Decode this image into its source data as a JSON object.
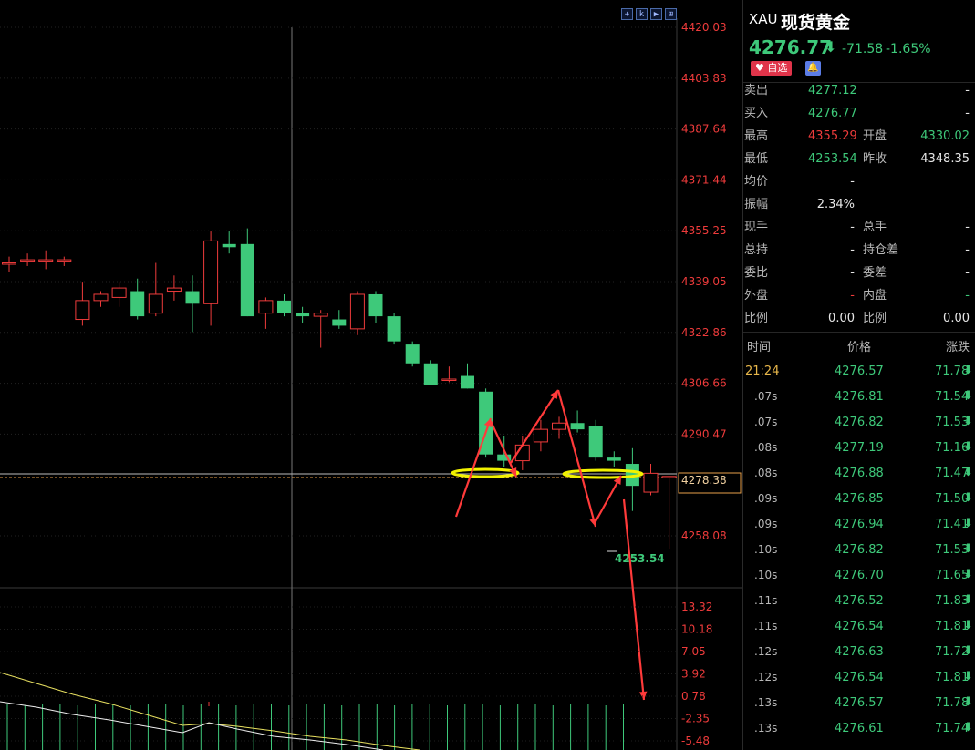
{
  "toolbar": {
    "buttons": [
      {
        "name": "crosshair-icon",
        "glyph": "+"
      },
      {
        "name": "indicator-icon",
        "glyph": "k"
      },
      {
        "name": "play-icon",
        "glyph": "▶"
      },
      {
        "name": "fullscreen-icon",
        "glyph": "⊞"
      }
    ]
  },
  "chart_data": {
    "type": "candlestick",
    "title": "",
    "ylim": [
      4245,
      4425
    ],
    "price_ticks": [
      "4420.03",
      "4403.83",
      "4387.64",
      "4371.44",
      "4355.25",
      "4339.05",
      "4322.86",
      "4306.66",
      "4290.47",
      "4278.38",
      "4258.08"
    ],
    "current_price_label": "4278.38",
    "low_marker_label": "4253.54",
    "candles": [
      {
        "o": 4345,
        "h": 4347,
        "l": 4342,
        "c": 4345
      },
      {
        "o": 4346,
        "h": 4348,
        "l": 4344,
        "c": 4346
      },
      {
        "o": 4346,
        "h": 4349,
        "l": 4343,
        "c": 4346
      },
      {
        "o": 4346,
        "h": 4347,
        "l": 4344,
        "c": 4346
      },
      {
        "o": 4327,
        "h": 4339,
        "l": 4325,
        "c": 4333
      },
      {
        "o": 4333,
        "h": 4336,
        "l": 4331,
        "c": 4335
      },
      {
        "o": 4334,
        "h": 4339,
        "l": 4331,
        "c": 4337
      },
      {
        "o": 4336,
        "h": 4340,
        "l": 4327,
        "c": 4328
      },
      {
        "o": 4329,
        "h": 4345,
        "l": 4328,
        "c": 4335
      },
      {
        "o": 4336,
        "h": 4341,
        "l": 4333,
        "c": 4337
      },
      {
        "o": 4336,
        "h": 4341,
        "l": 4323,
        "c": 4332
      },
      {
        "o": 4332,
        "h": 4355,
        "l": 4325,
        "c": 4352
      },
      {
        "o": 4351,
        "h": 4355,
        "l": 4348,
        "c": 4350
      },
      {
        "o": 4351,
        "h": 4356,
        "l": 4328,
        "c": 4328
      },
      {
        "o": 4329,
        "h": 4334,
        "l": 4324,
        "c": 4333
      },
      {
        "o": 4333,
        "h": 4335,
        "l": 4328,
        "c": 4329
      },
      {
        "o": 4329,
        "h": 4331,
        "l": 4326,
        "c": 4328
      },
      {
        "o": 4328,
        "h": 4330,
        "l": 4318,
        "c": 4329
      },
      {
        "o": 4327,
        "h": 4330,
        "l": 4324,
        "c": 4325
      },
      {
        "o": 4324,
        "h": 4336,
        "l": 4322,
        "c": 4335
      },
      {
        "o": 4335,
        "h": 4336,
        "l": 4326,
        "c": 4328
      },
      {
        "o": 4328,
        "h": 4329,
        "l": 4319,
        "c": 4320
      },
      {
        "o": 4319,
        "h": 4320,
        "l": 4312,
        "c": 4313
      },
      {
        "o": 4313,
        "h": 4314,
        "l": 4306,
        "c": 4306
      },
      {
        "o": 4308,
        "h": 4312,
        "l": 4307,
        "c": 4308
      },
      {
        "o": 4309,
        "h": 4313,
        "l": 4305,
        "c": 4305
      },
      {
        "o": 4304,
        "h": 4305,
        "l": 4283,
        "c": 4284
      },
      {
        "o": 4284,
        "h": 4290,
        "l": 4280,
        "c": 4282
      },
      {
        "o": 4282,
        "h": 4290,
        "l": 4279,
        "c": 4287
      },
      {
        "o": 4288,
        "h": 4295,
        "l": 4285,
        "c": 4292
      },
      {
        "o": 4292,
        "h": 4296,
        "l": 4289,
        "c": 4294
      },
      {
        "o": 4294,
        "h": 4298,
        "l": 4291,
        "c": 4292
      },
      {
        "o": 4293,
        "h": 4295,
        "l": 4282,
        "c": 4283
      },
      {
        "o": 4283,
        "h": 4285,
        "l": 4280,
        "c": 4282
      },
      {
        "o": 4281,
        "h": 4286,
        "l": 4266,
        "c": 4274
      },
      {
        "o": 4272,
        "h": 4281,
        "l": 4271,
        "c": 4278
      },
      {
        "o": 4277,
        "h": 4277,
        "l": 4254,
        "c": 4277
      }
    ],
    "macd_ticks": [
      "13.32",
      "10.18",
      "7.05",
      "3.92",
      "0.78",
      "-2.35",
      "-5.48"
    ],
    "macd_ylim": [
      -5.8,
      14.5
    ]
  },
  "quote": {
    "symbol": "XAU",
    "name": "现货黄金",
    "price": "4276.77",
    "arrow": "⬇",
    "change": "-71.58",
    "change_pct": "-1.65%",
    "fav_label": "自选",
    "rows": [
      {
        "l1": "卖出",
        "v1": "4277.12",
        "c1": "green",
        "l2": "",
        "v2": "-",
        "c2": "white"
      },
      {
        "l1": "买入",
        "v1": "4276.77",
        "c1": "green",
        "l2": "",
        "v2": "-",
        "c2": "white"
      },
      {
        "l1": "最高",
        "v1": "4355.29",
        "c1": "red",
        "l2": "开盘",
        "v2": "4330.02",
        "c2": "green"
      },
      {
        "l1": "最低",
        "v1": "4253.54",
        "c1": "green",
        "l2": "昨收",
        "v2": "4348.35",
        "c2": "white"
      },
      {
        "l1": "均价",
        "v1": "-",
        "c1": "white",
        "l2": "",
        "v2": "",
        "c2": "white"
      },
      {
        "l1": "振幅",
        "v1": "2.34%",
        "c1": "white",
        "l2": "",
        "v2": "",
        "c2": "white"
      },
      {
        "l1": "现手",
        "v1": "-",
        "c1": "white",
        "l2": "总手",
        "v2": "-",
        "c2": "white"
      },
      {
        "l1": "总持",
        "v1": "-",
        "c1": "white",
        "l2": "持仓差",
        "v2": "-",
        "c2": "white"
      },
      {
        "l1": "委比",
        "v1": "-",
        "c1": "white",
        "l2": "委差",
        "v2": "-",
        "c2": "white"
      },
      {
        "l1": "外盘",
        "v1": "-",
        "c1": "red",
        "l2": "内盘",
        "v2": "-",
        "c2": "green"
      },
      {
        "l1": "比例",
        "v1": "0.00",
        "c1": "white",
        "l2": "比例",
        "v2": "0.00",
        "c2": "white"
      }
    ]
  },
  "ticks": {
    "headers": {
      "time": "时间",
      "price": "价格",
      "change": "涨跌"
    },
    "rows": [
      {
        "t": "21:24",
        "p": "4276.57",
        "c": "71.78"
      },
      {
        "t": ".07s",
        "p": "4276.81",
        "c": "71.54"
      },
      {
        "t": ".07s",
        "p": "4276.82",
        "c": "71.53"
      },
      {
        "t": ".08s",
        "p": "4277.19",
        "c": "71.16"
      },
      {
        "t": ".08s",
        "p": "4276.88",
        "c": "71.47"
      },
      {
        "t": ".09s",
        "p": "4276.85",
        "c": "71.50"
      },
      {
        "t": ".09s",
        "p": "4276.94",
        "c": "71.41"
      },
      {
        "t": ".10s",
        "p": "4276.82",
        "c": "71.53"
      },
      {
        "t": ".10s",
        "p": "4276.70",
        "c": "71.65"
      },
      {
        "t": ".11s",
        "p": "4276.52",
        "c": "71.83"
      },
      {
        "t": ".11s",
        "p": "4276.54",
        "c": "71.81"
      },
      {
        "t": ".12s",
        "p": "4276.63",
        "c": "71.72"
      },
      {
        "t": ".12s",
        "p": "4276.54",
        "c": "71.81"
      },
      {
        "t": ".13s",
        "p": "4276.57",
        "c": "71.78"
      },
      {
        "t": ".13s",
        "p": "4276.61",
        "c": "71.74"
      }
    ],
    "arrow": "⬇"
  },
  "colors": {
    "up": "#ee3b3b",
    "down": "#3ec97a",
    "annotation": "#ff3a3a",
    "highlight": "#f2f200",
    "price_line": "#e8a04a"
  }
}
